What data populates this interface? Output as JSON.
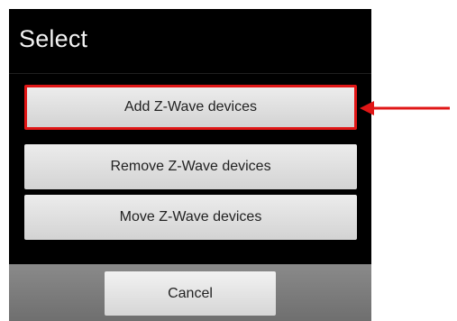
{
  "dialog": {
    "title": "Select",
    "options": [
      {
        "label": "Add Z-Wave devices"
      },
      {
        "label": "Remove Z-Wave devices"
      },
      {
        "label": "Move Z-Wave devices"
      }
    ],
    "cancel_label": "Cancel"
  },
  "annotation": {
    "highlight_color": "#e01616",
    "arrow_color": "#e01616"
  }
}
